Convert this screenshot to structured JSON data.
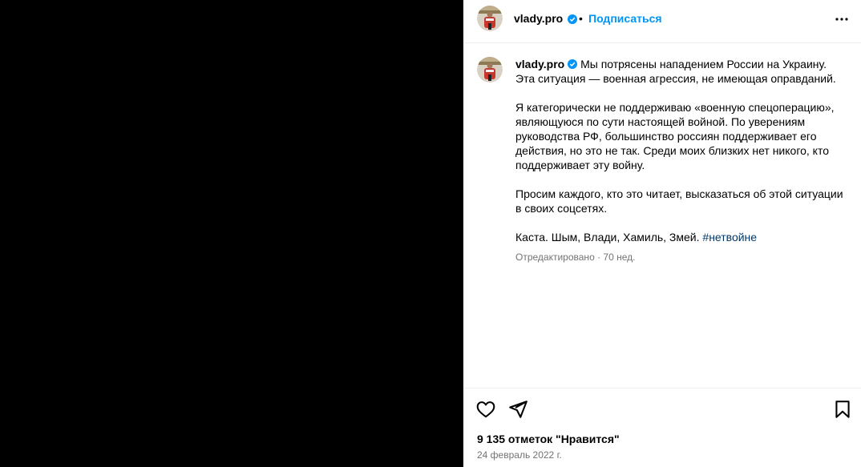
{
  "post": {
    "username": "vlady.pro",
    "separator": "•",
    "follow_label": "Подписаться",
    "caption_paragraphs": [
      "Мы потрясены нападением России на Украину. Эта ситуация — военная агрессия, не имеющая оправданий.",
      "Я категорически не поддерживаю «военную спецоперацию», являющуюся по сути настоящей войной. По уверениям руководства РФ, большинство россиян поддерживает его действия, но это не так. Среди моих близких нет никого, кто поддерживает эту войну.",
      "Просим каждого, кто это читает, высказаться об этой ситуации в своих соцсетях."
    ],
    "signature": "Каста. Шым, Влади, Хамиль, Змей. ",
    "hashtag": "#нетвойне",
    "edited_label": "Отредактировано · 70 нед.",
    "likes_text": "9 135 отметок \"Нравится\"",
    "date_text": "24 февраль 2022 г."
  },
  "icons": {
    "verified": "verified-badge-icon",
    "more": "more-options-icon",
    "like": "heart-icon",
    "share": "share-icon",
    "save": "bookmark-icon"
  },
  "colors": {
    "accent": "#0095f6",
    "verified": "#0095f6",
    "hashtag": "#00376b",
    "secondary_text": "#737373",
    "media_bg": "#000000"
  }
}
